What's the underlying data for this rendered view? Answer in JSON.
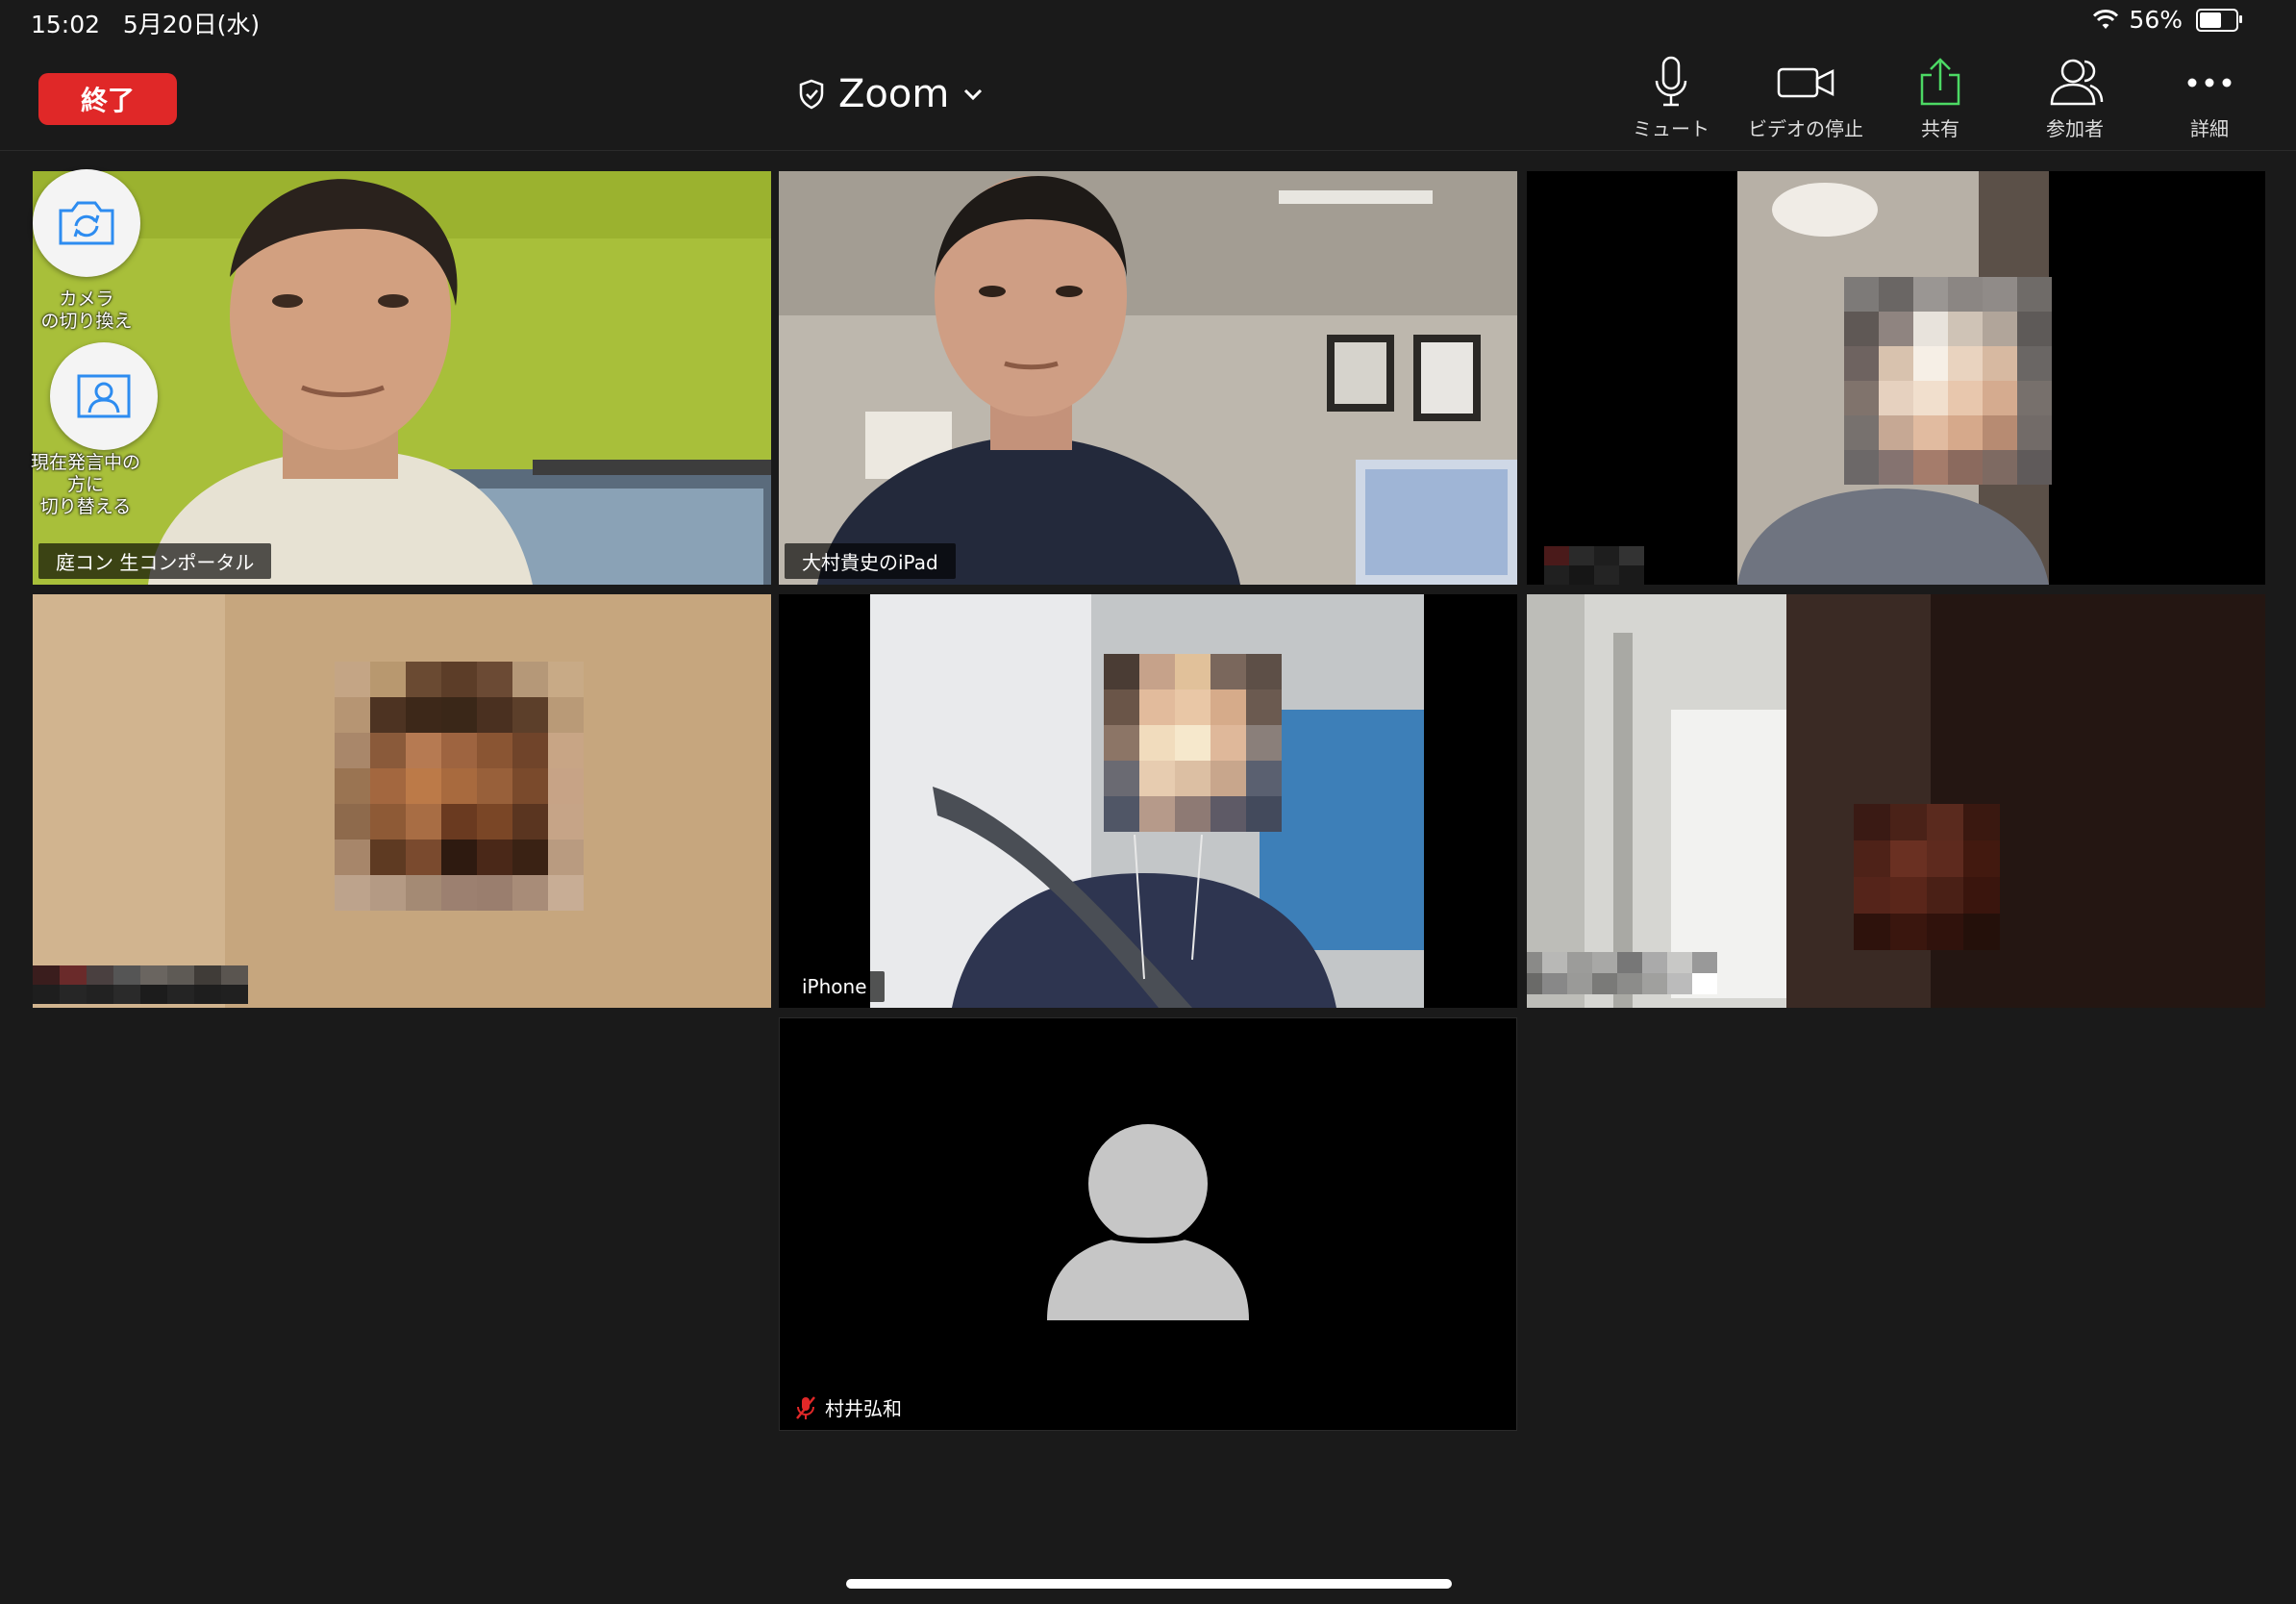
{
  "status": {
    "time": "15:02",
    "date": "5月20日(水)",
    "battery": "56%"
  },
  "toolbar": {
    "end_label": "終了",
    "title": "Zoom",
    "buttons": [
      {
        "label": "ミュート"
      },
      {
        "label": "ビデオの停止"
      },
      {
        "label": "共有"
      },
      {
        "label": "参加者"
      },
      {
        "label": "詳細"
      }
    ]
  },
  "self_controls": {
    "switch_camera": "カメラ\nの切り換え",
    "switch_speaker": "現在発言中の\n方に\n切り替える"
  },
  "participants": [
    {
      "name": "庭コン 生コンポータル"
    },
    {
      "name": "大村貴史のiPad",
      "active": true
    },
    {
      "name": ""
    },
    {
      "name": ""
    },
    {
      "name": "iPhone"
    },
    {
      "name": ""
    },
    {
      "name": "村井弘和",
      "muted": true
    }
  ],
  "colors": {
    "end": "#e02828",
    "share": "#4cd964",
    "active_border": "#7ed957"
  }
}
